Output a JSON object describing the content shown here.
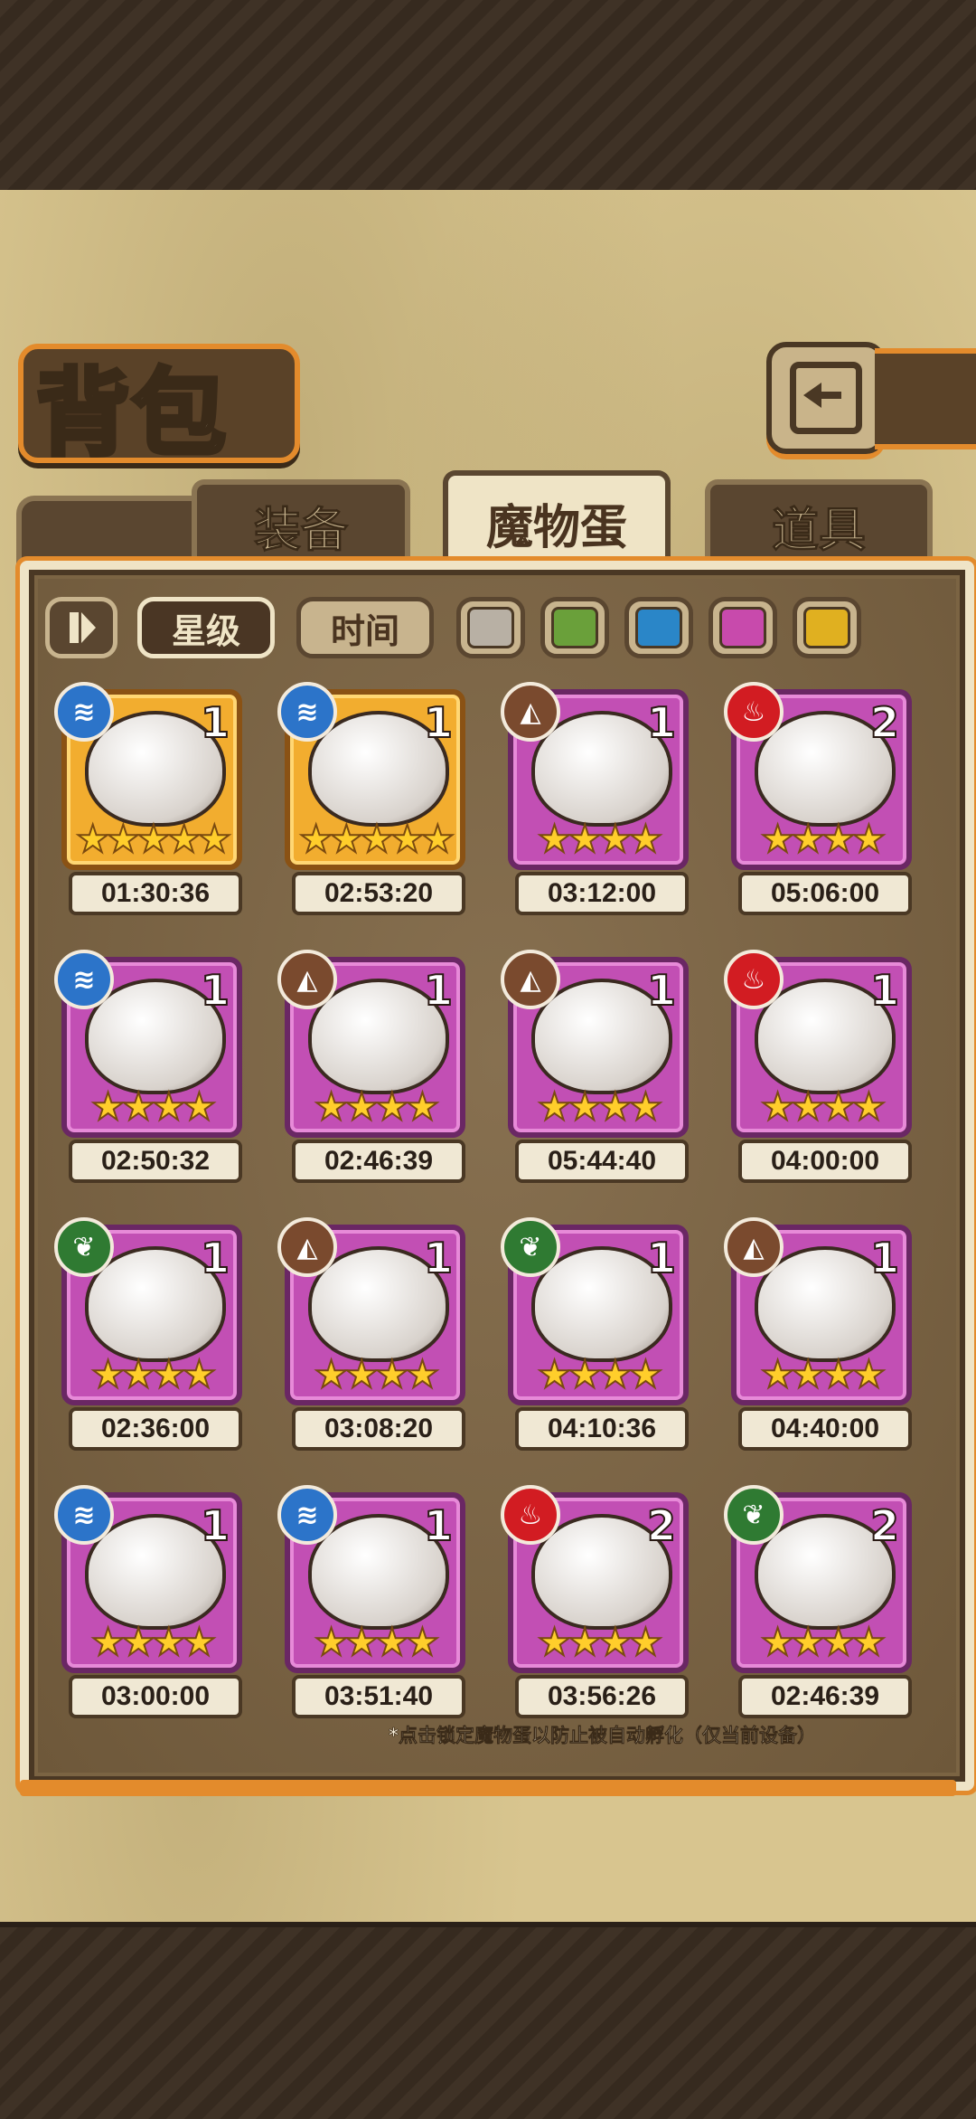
{
  "header": {
    "title": "背包"
  },
  "tabs": [
    {
      "label": "装备",
      "active": false
    },
    {
      "label": "魔物蛋",
      "active": true
    },
    {
      "label": "道具",
      "active": false
    }
  ],
  "sort": {
    "star_label": "星级",
    "time_label": "时间",
    "selected": "星级"
  },
  "color_filters": [
    "#b8b0a4",
    "#6aa03a",
    "#2a86c8",
    "#c84aac",
    "#e0b020"
  ],
  "eggs": [
    {
      "element": "water",
      "count": "1",
      "stars": 5,
      "time": "01:30:36",
      "rarity": "gold"
    },
    {
      "element": "water",
      "count": "1",
      "stars": 5,
      "time": "02:53:20",
      "rarity": "gold"
    },
    {
      "element": "earth",
      "count": "1",
      "stars": 4,
      "time": "03:12:00",
      "rarity": "purple"
    },
    {
      "element": "fire",
      "count": "2",
      "stars": 4,
      "time": "05:06:00",
      "rarity": "purple"
    },
    {
      "element": "water",
      "count": "1",
      "stars": 4,
      "time": "02:50:32",
      "rarity": "purple"
    },
    {
      "element": "earth",
      "count": "1",
      "stars": 4,
      "time": "02:46:39",
      "rarity": "purple"
    },
    {
      "element": "earth",
      "count": "1",
      "stars": 4,
      "time": "05:44:40",
      "rarity": "purple"
    },
    {
      "element": "fire",
      "count": "1",
      "stars": 4,
      "time": "04:00:00",
      "rarity": "purple"
    },
    {
      "element": "leaf",
      "count": "1",
      "stars": 4,
      "time": "02:36:00",
      "rarity": "purple"
    },
    {
      "element": "earth",
      "count": "1",
      "stars": 4,
      "time": "03:08:20",
      "rarity": "purple"
    },
    {
      "element": "leaf",
      "count": "1",
      "stars": 4,
      "time": "04:10:36",
      "rarity": "purple"
    },
    {
      "element": "earth",
      "count": "1",
      "stars": 4,
      "time": "04:40:00",
      "rarity": "purple"
    },
    {
      "element": "water",
      "count": "1",
      "stars": 4,
      "time": "03:00:00",
      "rarity": "purple"
    },
    {
      "element": "water",
      "count": "1",
      "stars": 4,
      "time": "03:51:40",
      "rarity": "purple"
    },
    {
      "element": "fire",
      "count": "2",
      "stars": 4,
      "time": "03:56:26",
      "rarity": "purple"
    },
    {
      "element": "leaf",
      "count": "2",
      "stars": 4,
      "time": "02:46:39",
      "rarity": "purple"
    }
  ],
  "footer_note": "*点击锁定魔物蛋以防止被自动孵化（仅当前设备）"
}
